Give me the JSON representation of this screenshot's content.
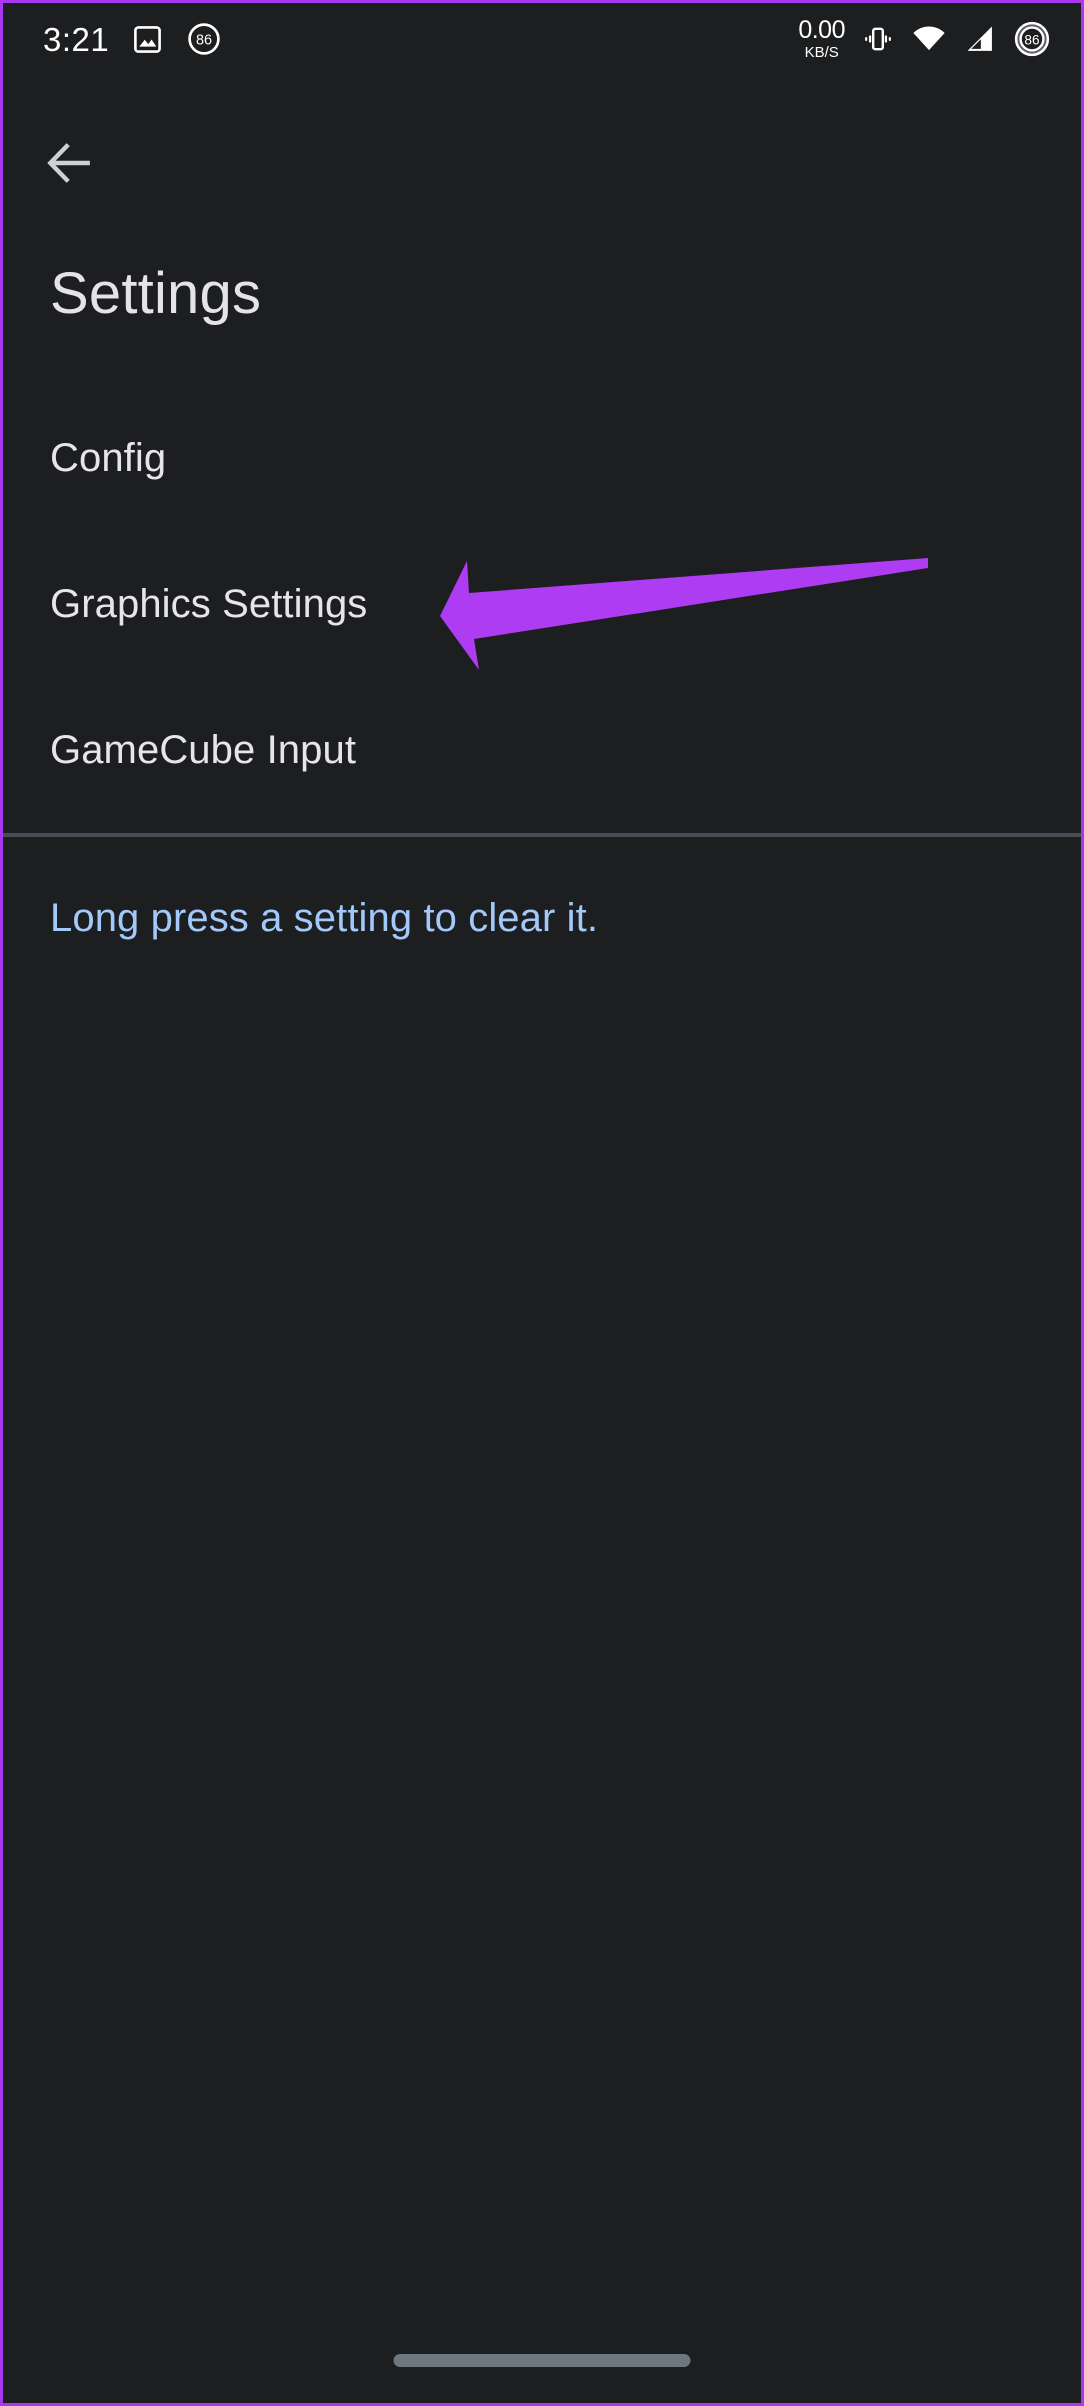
{
  "status_bar": {
    "clock": "3:21",
    "left_icons": [
      {
        "name": "photo-icon",
        "label": "photo"
      },
      {
        "name": "circle-badge-86-icon",
        "label": "86"
      }
    ],
    "network_speed": {
      "value": "0.00",
      "unit": "KB/S"
    },
    "right_icons": [
      {
        "name": "vibrate-icon",
        "label": "vibrate"
      },
      {
        "name": "wifi-icon",
        "label": "wifi"
      },
      {
        "name": "cell-signal-icon",
        "label": "signal"
      },
      {
        "name": "battery-icon",
        "label": "86"
      }
    ],
    "battery_level": "86"
  },
  "app_bar": {
    "back_label": "Back"
  },
  "page": {
    "title": "Settings"
  },
  "settings_list": {
    "items": [
      {
        "label": "Config"
      },
      {
        "label": "Graphics Settings"
      },
      {
        "label": "GameCube Input"
      }
    ]
  },
  "hint": {
    "text": "Long press a setting to clear it."
  },
  "annotation": {
    "arrow_name": "highlight-arrow-graphics-settings",
    "color": "#ae3cf2"
  },
  "colors": {
    "background": "#1d1e20",
    "divider": "#484e57",
    "primary_text": "#e6e6e8",
    "hint_text": "#a3c9fb",
    "accent_purple": "#a839f0",
    "home_indicator": "#6e767f"
  },
  "navigation": {
    "home_indicator_label": "Home"
  }
}
